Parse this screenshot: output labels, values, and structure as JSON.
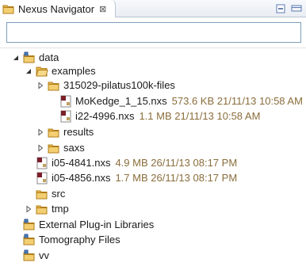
{
  "view": {
    "title": "Nexus Navigator",
    "close_glyph": "⊠",
    "menu_icons": [
      "collapse-all-icon",
      "view-menu-icon"
    ]
  },
  "filter": {
    "value": "",
    "placeholder": ""
  },
  "tree": {
    "data": {
      "label": "data",
      "expanded": true
    },
    "examples": {
      "label": "examples",
      "expanded": true
    },
    "pilatus": {
      "label": "315029-pilatus100k-files",
      "expanded": false
    },
    "mokedge": {
      "label": "MoKedge_1_15.nxs",
      "meta": "573.6 KB  21/11/13 10:58 AM"
    },
    "i22": {
      "label": "i22-4996.nxs",
      "meta": "1.1 MB  21/11/13 10:58 AM"
    },
    "results": {
      "label": "results",
      "expanded": false
    },
    "saxs": {
      "label": "saxs",
      "expanded": false
    },
    "i05_4841": {
      "label": "i05-4841.nxs",
      "meta": "4.9 MB  26/11/13 08:17 PM"
    },
    "i05_4856": {
      "label": "i05-4856.nxs",
      "meta": "1.7 MB  26/11/13 08:17 PM"
    },
    "src": {
      "label": "src"
    },
    "tmp": {
      "label": "tmp",
      "expanded": false
    },
    "ext_libs": {
      "label": "External Plug-in Libraries"
    },
    "tomography": {
      "label": "Tomography Files"
    },
    "vv": {
      "label": "vv"
    }
  },
  "colors": {
    "meta_text": "#8a6d3b",
    "folder": "#e8b84a",
    "file": "#7a1f2b"
  }
}
